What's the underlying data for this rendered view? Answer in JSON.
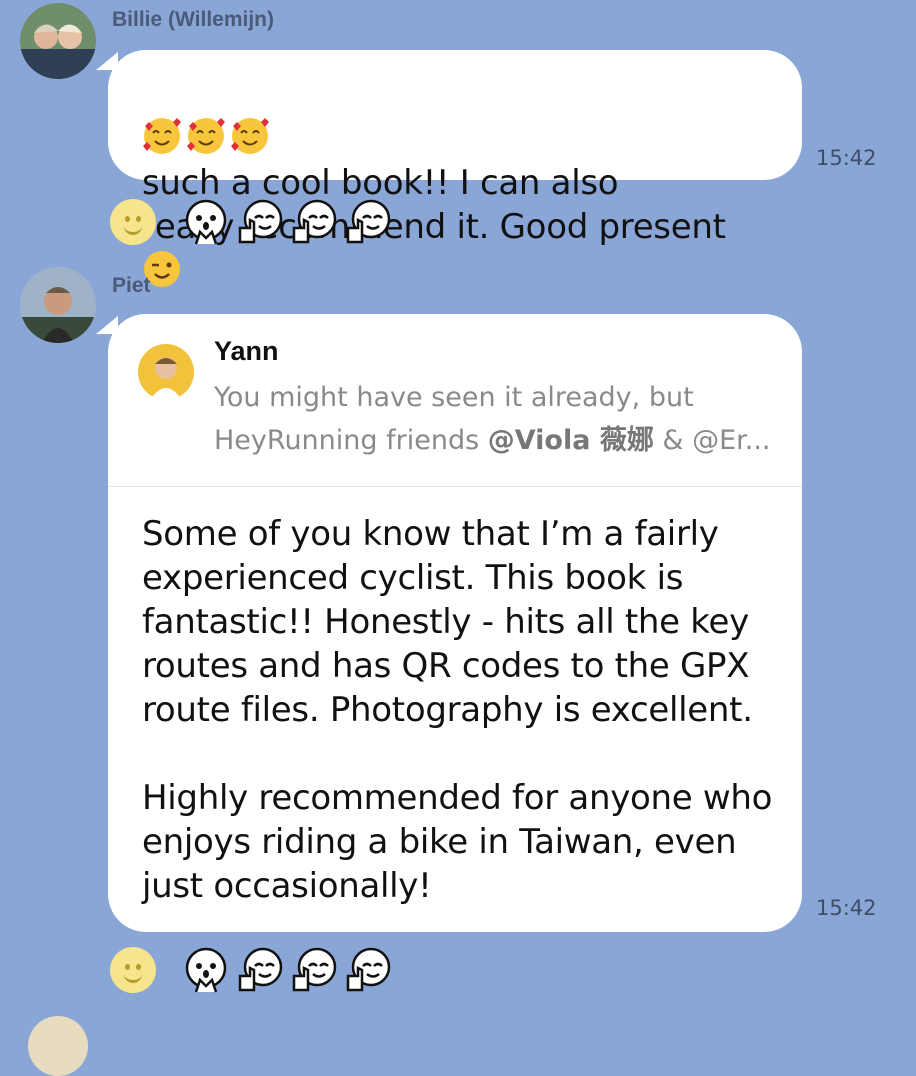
{
  "messages": [
    {
      "sender": "Billie (Willemijn)",
      "text": "such a cool book!! I can also\nreally recommend it. Good present",
      "time": "15:42",
      "leading_emojis": [
        "smiling-face-with-hearts",
        "smiling-face-with-hearts",
        "smiling-face-with-hearts"
      ],
      "trailing_emoji": "winking-face",
      "reactions": [
        "pleading-hands-sticker",
        "thumbs-up-sticker",
        "thumbs-up-sticker",
        "thumbs-up-sticker"
      ]
    },
    {
      "sender": "Piet",
      "reply": {
        "name": "Yann",
        "line1": "You might have seen it already, but",
        "line2_prefix": "HeyRunning friends ",
        "mention": "@Viola 薇娜",
        "line2_suffix": " & @Er..."
      },
      "text": "Some of you know that I’m a fairly\nexperienced cyclist. This book is\nfantastic!! Honestly - hits all the key\nroutes and has QR codes to the GPX\nroute files. Photography is excellent.\n\nHighly recommended for anyone who\nenjoys riding a bike in Taiwan, even\njust occasionally!",
      "time": "15:42",
      "reactions": [
        "pleading-hands-sticker",
        "thumbs-up-sticker",
        "thumbs-up-sticker",
        "thumbs-up-sticker"
      ]
    }
  ],
  "colors": {
    "background": "#8aa6d6",
    "bubble": "#ffffff",
    "sender": "#4a5a78",
    "time": "#3f4d66",
    "quote_text": "#8a8a8a"
  }
}
